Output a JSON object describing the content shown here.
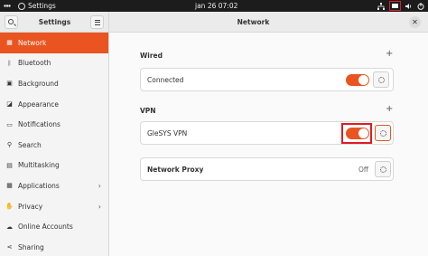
{
  "topbar": {
    "app_name": "Settings",
    "clock": "jan 26  07:02"
  },
  "header": {
    "sidebar_title": "Settings",
    "main_title": "Network",
    "close": "✕"
  },
  "sidebar": {
    "items": [
      {
        "label": "Network",
        "icon": "network-icon",
        "glyph": "▦",
        "active": true
      },
      {
        "label": "Bluetooth",
        "icon": "bluetooth-icon",
        "glyph": "ᛒ"
      },
      {
        "label": "Background",
        "icon": "background-icon",
        "glyph": "▣"
      },
      {
        "label": "Appearance",
        "icon": "appearance-icon",
        "glyph": "◪"
      },
      {
        "label": "Notifications",
        "icon": "notifications-icon",
        "glyph": "▭"
      },
      {
        "label": "Search",
        "icon": "search-icon",
        "glyph": "⚲"
      },
      {
        "label": "Multitasking",
        "icon": "multitasking-icon",
        "glyph": "▤"
      },
      {
        "label": "Applications",
        "icon": "applications-icon",
        "glyph": "▦",
        "chevron": "›"
      },
      {
        "label": "Privacy",
        "icon": "privacy-icon",
        "glyph": "✋",
        "chevron": "›"
      },
      {
        "label": "Online Accounts",
        "icon": "online-accounts-icon",
        "glyph": "☁"
      },
      {
        "label": "Sharing",
        "icon": "sharing-icon",
        "glyph": "⋖"
      }
    ]
  },
  "main": {
    "wired": {
      "heading": "Wired",
      "add": "+",
      "connection_label": "Connected",
      "enabled": true
    },
    "vpn": {
      "heading": "VPN",
      "add": "+",
      "connection_label": "GleSYS VPN",
      "enabled": true
    },
    "proxy": {
      "label": "Network Proxy",
      "status": "Off"
    }
  },
  "colors": {
    "accent": "#e95420",
    "highlight": "#e01b24",
    "topbar": "#1c1c1c"
  }
}
